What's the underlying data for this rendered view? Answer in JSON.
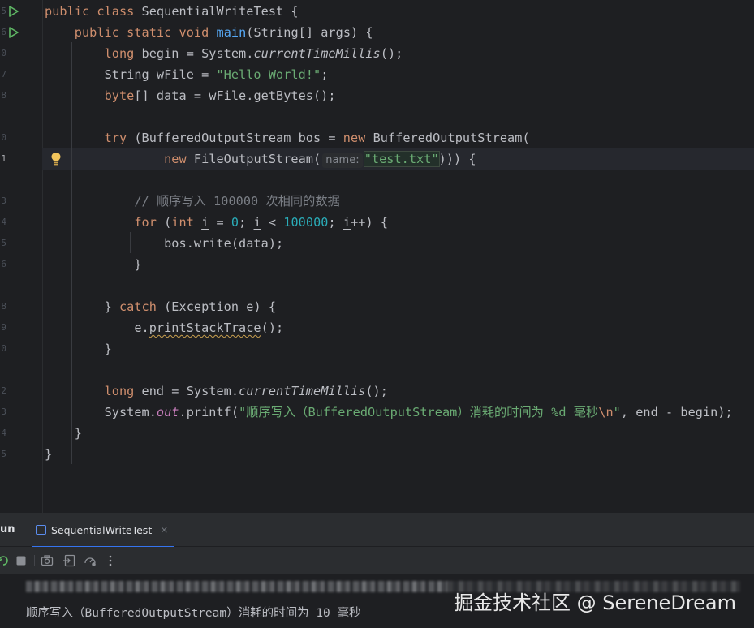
{
  "editor": {
    "line_numbers": [
      "5",
      "6",
      "0",
      "7",
      "8",
      "9",
      "0",
      "1",
      "2",
      "3",
      "4",
      "5",
      "6",
      "7",
      "8",
      "9",
      "0",
      "1",
      "2",
      "3",
      "4",
      "5"
    ],
    "code": {
      "l1": {
        "kw1": "public",
        "kw2": "class",
        "name": "SequentialWriteTest",
        "rest": " {"
      },
      "l2": {
        "kw1": "public",
        "kw2": "static",
        "kw3": "void",
        "fn": "main",
        "rest": "(String[] args) {"
      },
      "l3": {
        "kw": "long",
        "a": " begin = System.",
        "m": "currentTimeMillis",
        "b": "();"
      },
      "l4": {
        "a": "String wFile = ",
        "s": "\"Hello World!\"",
        "b": ";"
      },
      "l5": {
        "kw": "byte",
        "a": "[] data = wFile.getBytes();"
      },
      "l6": {
        "kw": "try",
        "a": " (BufferedOutputStream bos = ",
        "kw2": "new",
        "b": " BufferedOutputStream("
      },
      "l7": {
        "kw": "new",
        "a": " FileOutputStream(",
        "hint": "name:",
        "s": "\"test.txt\"",
        "b": "))) {"
      },
      "l8": {
        "c": "// 顺序写入 100000 次相同的数据"
      },
      "l9": {
        "kw": "for",
        "a": " (",
        "kw2": "int",
        "sp": " ",
        "v": "i",
        "eq": " = ",
        "n": "0",
        "semi": "; ",
        "v2": "i",
        "lt": " < ",
        "n2": "100000",
        "semi2": "; ",
        "v3": "i",
        "inc": "++) {"
      },
      "l10": {
        "a": "bos.write(data);"
      },
      "l11": {
        "a": "}"
      },
      "l12": {
        "a": "} ",
        "kw": "catch",
        "b": " (Exception e) {"
      },
      "l13": {
        "a": "e.",
        "w": "printStackTrace",
        "b": "();"
      },
      "l14": {
        "a": "}"
      },
      "l15": {
        "kw": "long",
        "a": " end = System.",
        "m": "currentTimeMillis",
        "b": "();"
      },
      "l16": {
        "a": "System.",
        "sf": "out",
        "b": ".printf(",
        "s": "\"顺序写入（BufferedOutputStream）消耗的时间为 %d 毫秒",
        "esc": "\\n",
        "s2": "\"",
        "c": ", end - begin);"
      },
      "l17": {
        "a": "}"
      },
      "l18": {
        "a": "}"
      }
    }
  },
  "run_panel": {
    "title": "un",
    "tab_label": "SequentialWriteTest",
    "tab_close": "×",
    "output_line": "顺序写入（BufferedOutputStream）消耗的时间为 10 毫秒",
    "watermark": "掘金技术社区 @ SereneDream"
  },
  "colors": {
    "keyword": "#cf8e6d",
    "function": "#56a8f5",
    "string": "#6aab73",
    "number": "#2aacb8",
    "comment": "#7a7e85",
    "static_field": "#c77dbb"
  }
}
